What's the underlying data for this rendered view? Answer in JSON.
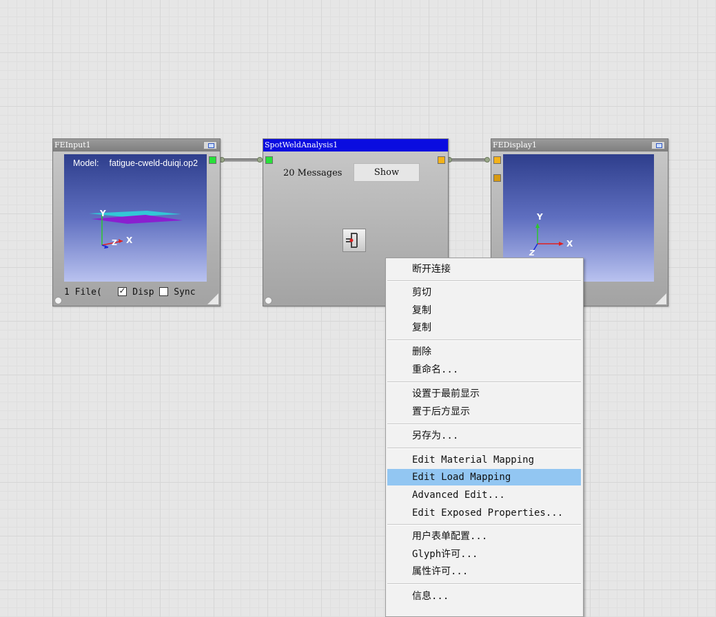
{
  "nodes": {
    "fe_input": {
      "title": "FEInput1",
      "model_label": "Model:",
      "model_value": "fatigue-cweld-duiqi.op2",
      "files": "1 File(",
      "disp_label": "Disp",
      "disp_checked": true,
      "sync_label": "Sync",
      "sync_checked": false,
      "axes": {
        "y": "Y",
        "x": "X",
        "z": "Z"
      }
    },
    "spot_weld": {
      "title": "SpotWeldAnalysis1",
      "messages": "20 Messages",
      "show_button": "Show"
    },
    "fe_display": {
      "title": "FEDisplay1",
      "axes": {
        "y": "Y",
        "x": "X",
        "z": "Z"
      }
    }
  },
  "context_menu": {
    "items": [
      {
        "label": "断开连接"
      },
      {
        "label": "剪切"
      },
      {
        "label": "复制"
      },
      {
        "label": "复制"
      },
      {
        "label": "删除"
      },
      {
        "label": "重命名..."
      },
      {
        "label": "设置于最前显示"
      },
      {
        "label": "置于后方显示"
      },
      {
        "label": "另存为..."
      },
      {
        "label": "Edit Material Mapping"
      },
      {
        "label": "Edit Load Mapping",
        "highlighted": true
      },
      {
        "label": "Advanced Edit..."
      },
      {
        "label": "Edit Exposed Properties..."
      },
      {
        "label": "用户表单配置..."
      },
      {
        "label": "Glyph许可..."
      },
      {
        "label": "属性许可..."
      },
      {
        "label": "信息..."
      }
    ]
  },
  "colors": {
    "canvas": "#e6e6e6",
    "active_title": "#0a0ce0",
    "highlight": "#92c6f2",
    "port_green": "#28e03a",
    "port_orange": "#f3b21a"
  }
}
